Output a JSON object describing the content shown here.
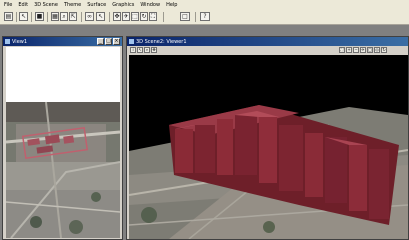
{
  "menu": [
    "File",
    "Edit",
    "3D Scene",
    "Theme",
    "Surface",
    "Graphics",
    "Window",
    "Help"
  ],
  "toolbar": {
    "icons": [
      "view-icon",
      "cursor-icon",
      "layer-icon",
      "scene-icon",
      "zoom-icon",
      "measure-icon",
      "binoculars-icon",
      "pointer-icon",
      "navigate-icon",
      "fly-icon",
      "select-icon",
      "rotate-icon",
      "extent-icon",
      "window-icon",
      "help-icon"
    ]
  },
  "view1": {
    "title": "View1"
  },
  "viewer": {
    "title": "3D Scene2: Viewer1",
    "icons": [
      "info-icon",
      "navigate-icon",
      "zoom-icon",
      "pan-icon"
    ],
    "right_icons": [
      "extent-icon",
      "zoom-in-icon",
      "zoom-out-icon",
      "fly-icon",
      "full-icon",
      "target-icon",
      "rotate-icon"
    ]
  },
  "colors": {
    "extrusion": "#8a2a36",
    "sky": "#000000",
    "titlebar": "#0a246a"
  }
}
